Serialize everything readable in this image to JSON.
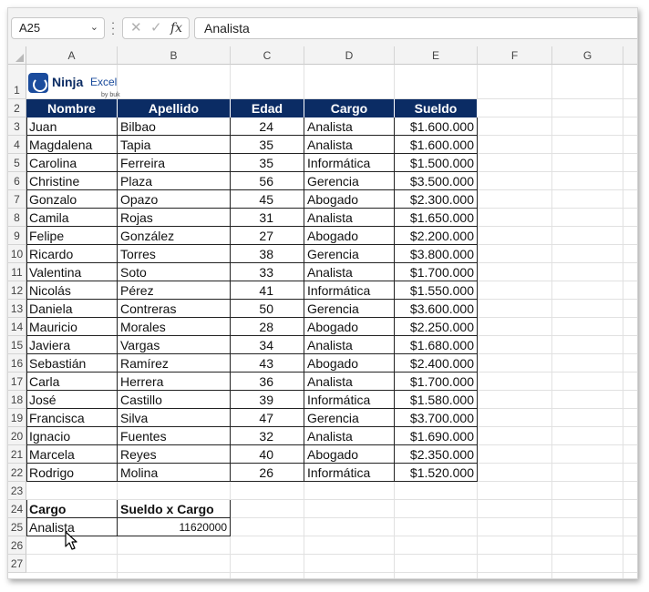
{
  "formula_bar": {
    "name_box": "A25",
    "formula_value": "Analista",
    "fx_label": "fx",
    "cancel_glyph": "✕",
    "enter_glyph": "✓"
  },
  "columns": [
    "A",
    "B",
    "C",
    "D",
    "E",
    "F",
    "G"
  ],
  "rows": [
    "1",
    "2",
    "3",
    "4",
    "5",
    "6",
    "7",
    "8",
    "9",
    "10",
    "11",
    "12",
    "13",
    "14",
    "15",
    "16",
    "17",
    "18",
    "19",
    "20",
    "21",
    "22",
    "23",
    "24",
    "25",
    "26",
    "27"
  ],
  "logo": {
    "brand": "Ninja",
    "product": "Excel",
    "byline": "by buk"
  },
  "table": {
    "headers": [
      "Nombre",
      "Apellido",
      "Edad",
      "Cargo",
      "Sueldo"
    ],
    "rows": [
      [
        "Juan",
        "Bilbao",
        "24",
        "Analista",
        "$1.600.000"
      ],
      [
        "Magdalena",
        "Tapia",
        "35",
        "Analista",
        "$1.600.000"
      ],
      [
        "Carolina",
        "Ferreira",
        "35",
        "Informática",
        "$1.500.000"
      ],
      [
        "Christine",
        "Plaza",
        "56",
        "Gerencia",
        "$3.500.000"
      ],
      [
        "Gonzalo",
        "Opazo",
        "45",
        "Abogado",
        "$2.300.000"
      ],
      [
        "Camila",
        "Rojas",
        "31",
        "Analista",
        "$1.650.000"
      ],
      [
        "Felipe",
        "González",
        "27",
        "Abogado",
        "$2.200.000"
      ],
      [
        "Ricardo",
        "Torres",
        "38",
        "Gerencia",
        "$3.800.000"
      ],
      [
        "Valentina",
        "Soto",
        "33",
        "Analista",
        "$1.700.000"
      ],
      [
        "Nicolás",
        "Pérez",
        "41",
        "Informática",
        "$1.550.000"
      ],
      [
        "Daniela",
        "Contreras",
        "50",
        "Gerencia",
        "$3.600.000"
      ],
      [
        "Mauricio",
        "Morales",
        "28",
        "Abogado",
        "$2.250.000"
      ],
      [
        "Javiera",
        "Vargas",
        "34",
        "Analista",
        "$1.680.000"
      ],
      [
        "Sebastián",
        "Ramírez",
        "43",
        "Abogado",
        "$2.400.000"
      ],
      [
        "Carla",
        "Herrera",
        "36",
        "Analista",
        "$1.700.000"
      ],
      [
        "José",
        "Castillo",
        "39",
        "Informática",
        "$1.580.000"
      ],
      [
        "Francisca",
        "Silva",
        "47",
        "Gerencia",
        "$3.700.000"
      ],
      [
        "Ignacio",
        "Fuentes",
        "32",
        "Analista",
        "$1.690.000"
      ],
      [
        "Marcela",
        "Reyes",
        "40",
        "Abogado",
        "$2.350.000"
      ],
      [
        "Rodrigo",
        "Molina",
        "26",
        "Informática",
        "$1.520.000"
      ]
    ]
  },
  "summary": {
    "headers": [
      "Cargo",
      "Sueldo x Cargo"
    ],
    "row": [
      "Analista",
      "11620000"
    ]
  },
  "colors": {
    "header_bg": "#0b2c64",
    "header_text": "#ffffff"
  }
}
